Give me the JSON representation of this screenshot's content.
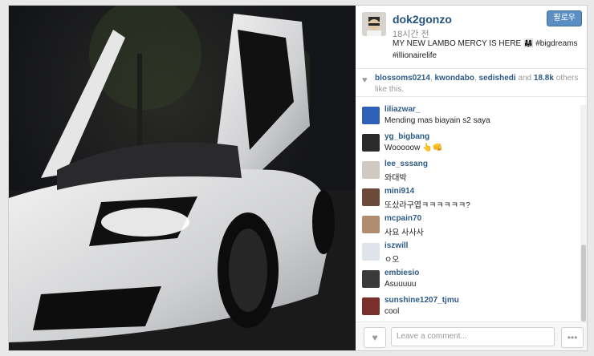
{
  "post": {
    "username": "dok2gonzo",
    "time": "18시간 전",
    "caption": "MY NEW LAMBO MERCY IS HERE 👨‍👩‍👧 #bigdreams #illionairelife",
    "follow_label": "팔로우"
  },
  "likes": {
    "user1": "blossoms0214",
    "user2": "kwondabo",
    "user3": "sedishedi",
    "and_label": "and",
    "count": "18.8k",
    "suffix": "others like this."
  },
  "comments": [
    {
      "user": "liliazwar_",
      "text": "Mending mas biayain s2 saya"
    },
    {
      "user": "yg_bigbang",
      "text": "Wooooow 👆👊"
    },
    {
      "user": "lee_sssang",
      "text": "와대박"
    },
    {
      "user": "mini914",
      "text": "또샀라구엽ㅋㅋㅋㅋㅋㅋ?"
    },
    {
      "user": "mcpain70",
      "text": "사요 사사사"
    },
    {
      "user": "iszwill",
      "text": "ㅇ오"
    },
    {
      "user": "embiesio",
      "text": "Asuuuuu"
    },
    {
      "user": "sunshine1207_tjmu",
      "text": "cool"
    }
  ],
  "comment_box": {
    "placeholder": "Leave a comment...",
    "more_label": "•••"
  },
  "icons": {
    "heart": "heart-icon",
    "more": "more-icon"
  }
}
